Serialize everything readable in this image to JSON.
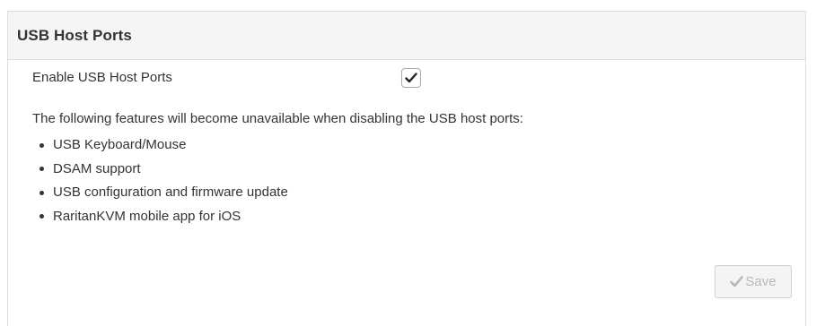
{
  "panel": {
    "title": "USB Host Ports"
  },
  "settings": {
    "enable_label": "Enable USB Host Ports",
    "enable_checked": true
  },
  "notice": {
    "text": "The following features will become unavailable when disabling the USB host ports:",
    "features": [
      "USB Keyboard/Mouse",
      "DSAM support",
      "USB configuration and firmware update",
      "RaritanKVM mobile app for iOS"
    ]
  },
  "actions": {
    "save_label": "Save",
    "save_enabled": false,
    "save_icon": "checkmark-icon"
  },
  "colors": {
    "header_bg": "#f5f5f5",
    "border": "#dddddd",
    "text": "#333333",
    "disabled_text": "#b8b8b8"
  }
}
